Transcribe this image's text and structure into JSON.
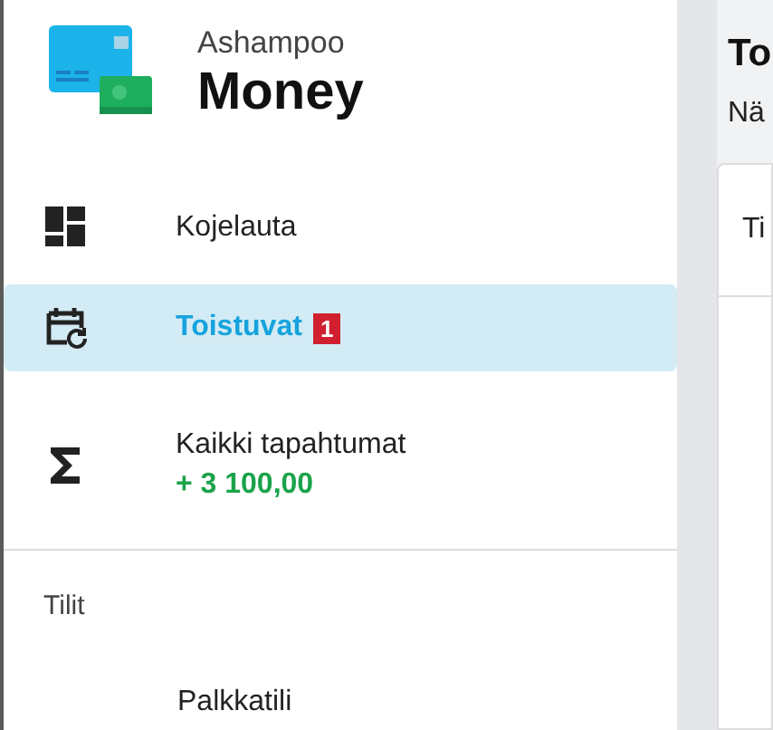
{
  "app": {
    "brand": "Ashampoo",
    "product": "Money"
  },
  "nav": [
    {
      "kind": "dashboard",
      "label": "Kojelauta",
      "selected": false
    },
    {
      "kind": "recurring",
      "label": "Toistuvat",
      "badge": "1",
      "selected": true
    },
    {
      "kind": "all",
      "label": "Kaikki tapahtumat",
      "amount": "+ 3 100,00",
      "selected": false
    }
  ],
  "accounts": {
    "heading": "Tilit",
    "items": [
      {
        "label": "Palkkatili"
      }
    ]
  },
  "main": {
    "title": "To",
    "subtitle": "Nä",
    "table": {
      "columns": [
        "Ti"
      ]
    }
  }
}
